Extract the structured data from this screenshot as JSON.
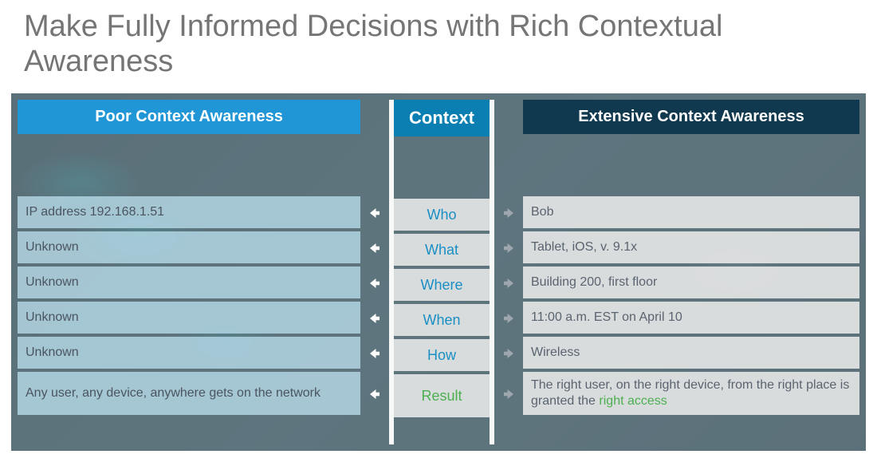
{
  "title": "Make Fully Informed Decisions with Rich Contextual Awareness",
  "headers": {
    "poor": "Poor Context Awareness",
    "context": "Context",
    "extensive": "Extensive Context Awareness"
  },
  "rows": [
    {
      "poor": "IP address 192.168.1.51",
      "context": "Who",
      "ext": "Bob"
    },
    {
      "poor": "Unknown",
      "context": "What",
      "ext": "Tablet, iOS, v. 9.1x"
    },
    {
      "poor": "Unknown",
      "context": "Where",
      "ext": "Building 200, first floor"
    },
    {
      "poor": "Unknown",
      "context": "When",
      "ext": "11:00 a.m. EST on April 10"
    },
    {
      "poor": "Unknown",
      "context": "How",
      "ext": "Wireless"
    }
  ],
  "result": {
    "poor": "Any user, any device, anywhere gets on the network",
    "context": "Result",
    "ext_prefix": "The right user, on the right device, from the right place is granted the ",
    "ext_highlight": "right access"
  }
}
